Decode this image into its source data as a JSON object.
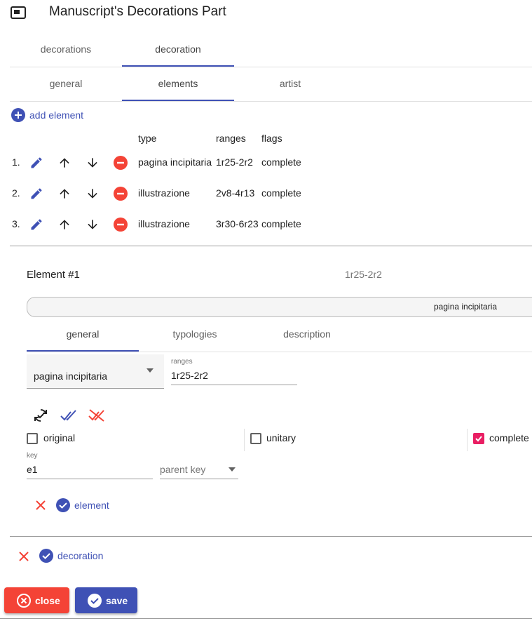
{
  "header": {
    "title": "Manuscript's Decorations Part",
    "icon": "picture-in-picture-icon"
  },
  "top_tabs": [
    {
      "label": "decorations",
      "active": false
    },
    {
      "label": "decoration",
      "active": true
    }
  ],
  "decoration_tabs": [
    {
      "label": "general",
      "active": false
    },
    {
      "label": "elements",
      "active": true
    },
    {
      "label": "artist",
      "active": false
    }
  ],
  "add_element": {
    "label": "add element",
    "icon": "add-circle-icon"
  },
  "elements_table": {
    "headers": {
      "type": "type",
      "ranges": "ranges",
      "flags": "flags"
    },
    "rows": [
      {
        "index": "1.",
        "type": "pagina incipitaria",
        "ranges": "1r25-2r2",
        "flags": "complete"
      },
      {
        "index": "2.",
        "type": "illustrazione",
        "ranges": "2v8-4r13",
        "flags": "complete"
      },
      {
        "index": "3.",
        "type": "illustrazione",
        "ranges": "3r30-6r23",
        "flags": "complete"
      }
    ]
  },
  "element_editor": {
    "title": "Element #1",
    "range_summary": "1r25-2r2",
    "chip_text": "pagina incipitaria",
    "tabs": [
      {
        "label": "general",
        "active": true
      },
      {
        "label": "typologies",
        "active": false
      },
      {
        "label": "description",
        "active": false
      }
    ],
    "type_select_value": "pagina incipitaria",
    "ranges_label": "ranges",
    "ranges_value": "1r25-2r2",
    "flags": [
      {
        "label": "original",
        "checked": false
      },
      {
        "label": "unitary",
        "checked": false
      },
      {
        "label": "complete",
        "checked": true
      }
    ],
    "key_label": "key",
    "key_value": "e1",
    "parent_key_placeholder": "parent key",
    "save_label": "element"
  },
  "decoration_save_label": "decoration",
  "footer": {
    "close_label": "close",
    "save_label": "save"
  },
  "colors": {
    "accent": "#3f51b5",
    "warn": "#f44336",
    "checked": "#e91e63"
  }
}
